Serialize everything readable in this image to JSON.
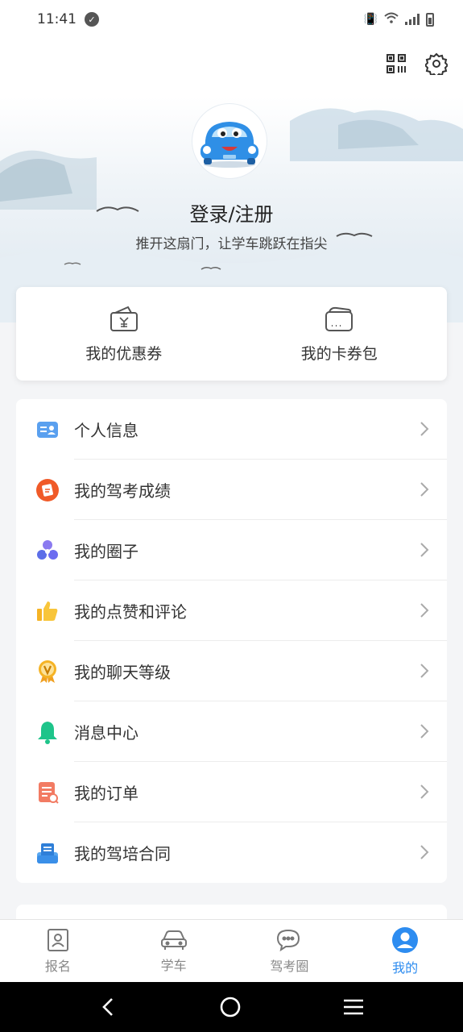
{
  "status": {
    "time": "11:41"
  },
  "profile": {
    "login_title": "登录/注册",
    "login_subtitle": "推开这扇门，让学车跳跃在指尖"
  },
  "coupons": [
    {
      "label": "我的优惠券",
      "icon": "coupon-icon"
    },
    {
      "label": "我的卡券包",
      "icon": "wallet-icon"
    }
  ],
  "menu": [
    {
      "label": "个人信息",
      "icon": "id-card-icon",
      "color": "#4a90e2"
    },
    {
      "label": "我的驾考成绩",
      "icon": "exam-score-icon",
      "color": "#f05a28"
    },
    {
      "label": "我的圈子",
      "icon": "circle-group-icon",
      "color": "#6c6cf0"
    },
    {
      "label": "我的点赞和评论",
      "icon": "thumb-up-icon",
      "color": "#f5b325"
    },
    {
      "label": "我的聊天等级",
      "icon": "chat-level-icon",
      "color": "#f5b325"
    },
    {
      "label": "消息中心",
      "icon": "bell-icon",
      "color": "#1ec48a"
    },
    {
      "label": "我的订单",
      "icon": "order-icon",
      "color": "#f27b63"
    },
    {
      "label": "我的驾培合同",
      "icon": "contract-icon",
      "color": "#3a8fe8"
    }
  ],
  "tabs": [
    {
      "label": "报名",
      "icon": "signup-icon",
      "active": false
    },
    {
      "label": "学车",
      "icon": "car-icon",
      "active": false
    },
    {
      "label": "驾考圈",
      "icon": "chat-bubble-icon",
      "active": false
    },
    {
      "label": "我的",
      "icon": "profile-icon",
      "active": true
    }
  ],
  "colors": {
    "accent": "#2d8cf0"
  }
}
